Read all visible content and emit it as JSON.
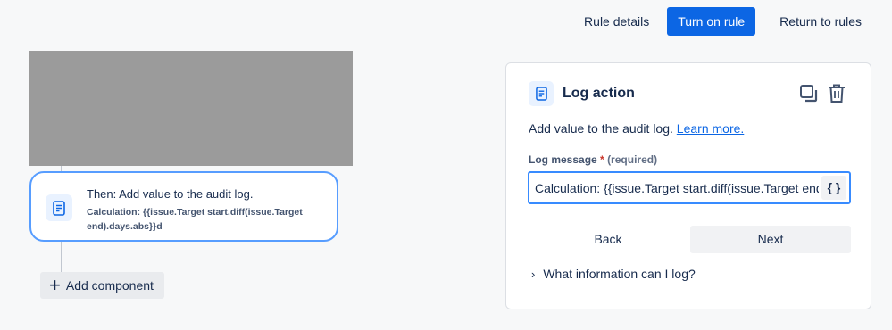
{
  "topbar": {
    "rule_details": "Rule details",
    "turn_on_rule": "Turn on rule",
    "return_to_rules": "Return to rules"
  },
  "flow": {
    "action_card": {
      "title": "Then: Add value to the audit log.",
      "subtitle": "Calculation: {{issue.Target start.diff(issue.Target end).days.abs}}d",
      "icon": "document-icon"
    },
    "add_component_label": "Add component"
  },
  "panel": {
    "title": "Log action",
    "description": "Add value to the audit log.",
    "learn_more": "Learn more.",
    "field_label": "Log message",
    "required_marker": "*",
    "required_text": "(required)",
    "field_value": "Calculation: {{issue.Target start.diff(issue.Target end).days.abs}}d",
    "smart_value_button": "{ }",
    "back_label": "Back",
    "next_label": "Next",
    "info_label": "What information can I log?"
  },
  "colors": {
    "primary": "#0c66e4",
    "card_border": "#579dff",
    "background": "#f7f8f9"
  }
}
